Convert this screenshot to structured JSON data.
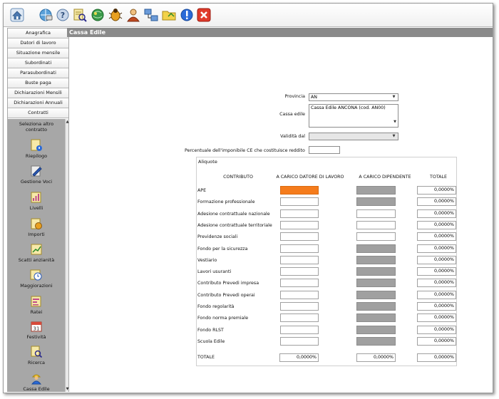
{
  "toolbar": {
    "icons": [
      "home-icon",
      "network-icon",
      "help-icon",
      "search-doc-icon",
      "globe-icon",
      "bug-icon",
      "user-icon",
      "connect-icon",
      "folder-icon",
      "info-icon",
      "close-icon"
    ]
  },
  "sidebar": {
    "items": [
      "Anagrafica",
      "Datori di lavoro",
      "Situazione mensile",
      "Subordinati",
      "Parasubordinati",
      "Buste paga",
      "Dichiarazioni Mensili",
      "Dichiarazioni Annuali",
      "Contratti"
    ],
    "select_other": "Seleziona altro contratto",
    "tools": [
      {
        "label": "Riepilogo",
        "icon": "summary-icon"
      },
      {
        "label": "Gestione Voci",
        "icon": "edit-items-icon"
      },
      {
        "label": "Livelli",
        "icon": "levels-icon"
      },
      {
        "label": "Importi",
        "icon": "amounts-icon"
      },
      {
        "label": "Scatti anzianità",
        "icon": "seniority-icon"
      },
      {
        "label": "Maggiorazioni",
        "icon": "clock-icon"
      },
      {
        "label": "Ratei",
        "icon": "installments-icon"
      },
      {
        "label": "Festività",
        "icon": "calendar-icon"
      },
      {
        "label": "Ricerca",
        "icon": "search-icon"
      },
      {
        "label": "Cassa Edile",
        "icon": "worker-icon"
      }
    ]
  },
  "page": {
    "title": "Cassa Edile"
  },
  "form": {
    "provincia_label": "Provincia",
    "provincia_value": "AN",
    "cassa_label": "Cassa edile",
    "cassa_value": "Cassa Edile ANCONA (cod. AN00)",
    "validita_label": "Validità dal",
    "validita_value": "",
    "percentuale_label": "Percentuale dell'imponibile CE che costituisce reddito",
    "percentuale_value": ""
  },
  "aliquote": {
    "title": "Aliquote",
    "headers": [
      "CONTRIBUTO",
      "A CARICO DATORE DI LAVORO",
      "A CARICO DIPENDENTE",
      "TOTALE"
    ],
    "rows": [
      {
        "label": "APE",
        "datore": "",
        "dipendente": "",
        "totale": "0,0000%",
        "datore_style": "orange",
        "dip_style": "gray"
      },
      {
        "label": "Formazione professionale",
        "datore": "",
        "dipendente": "",
        "totale": "0,0000%",
        "datore_style": "white",
        "dip_style": "gray"
      },
      {
        "label": "Adesione contrattuale nazionale",
        "datore": "",
        "dipendente": "",
        "totale": "0,0000%",
        "datore_style": "white",
        "dip_style": "white"
      },
      {
        "label": "Adesione contrattuale territoriale",
        "datore": "",
        "dipendente": "",
        "totale": "0,0000%",
        "datore_style": "white",
        "dip_style": "white"
      },
      {
        "label": "Previdenze sociali",
        "datore": "",
        "dipendente": "",
        "totale": "0,0000%",
        "datore_style": "white",
        "dip_style": "white"
      },
      {
        "label": "Fondo per la sicurezza",
        "datore": "",
        "dipendente": "",
        "totale": "0,0000%",
        "datore_style": "white",
        "dip_style": "gray"
      },
      {
        "label": "Vestiario",
        "datore": "",
        "dipendente": "",
        "totale": "0,0000%",
        "datore_style": "white",
        "dip_style": "gray"
      },
      {
        "label": "Lavori usuranti",
        "datore": "",
        "dipendente": "",
        "totale": "0,0000%",
        "datore_style": "white",
        "dip_style": "gray"
      },
      {
        "label": "Contributo Prevedi impresa",
        "datore": "",
        "dipendente": "",
        "totale": "0,0000%",
        "datore_style": "white",
        "dip_style": "gray"
      },
      {
        "label": "Contributo Prevedi operai",
        "datore": "",
        "dipendente": "",
        "totale": "0,0000%",
        "datore_style": "white",
        "dip_style": "gray"
      },
      {
        "label": "Fondo regolarità",
        "datore": "",
        "dipendente": "",
        "totale": "0,0000%",
        "datore_style": "white",
        "dip_style": "gray"
      },
      {
        "label": "Fondo norma premiale",
        "datore": "",
        "dipendente": "",
        "totale": "0,0000%",
        "datore_style": "white",
        "dip_style": "gray"
      },
      {
        "label": "Fondo RLST",
        "datore": "",
        "dipendente": "",
        "totale": "0,0000%",
        "datore_style": "white",
        "dip_style": "gray"
      },
      {
        "label": "Scuola Edile",
        "datore": "",
        "dipendente": "",
        "totale": "0,0000%",
        "datore_style": "white",
        "dip_style": "gray"
      }
    ],
    "totale_row": {
      "label": "TOTALE",
      "datore": "0,0000%",
      "dipendente": "0,0000%",
      "totale": "0,0000%"
    }
  }
}
